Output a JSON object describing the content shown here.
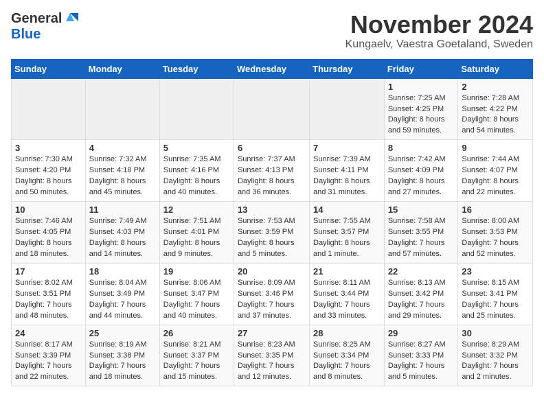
{
  "header": {
    "logo_general": "General",
    "logo_blue": "Blue",
    "month_title": "November 2024",
    "location": "Kungaelv, Vaestra Goetaland, Sweden"
  },
  "columns": [
    "Sunday",
    "Monday",
    "Tuesday",
    "Wednesday",
    "Thursday",
    "Friday",
    "Saturday"
  ],
  "weeks": [
    [
      {
        "day": "",
        "info": ""
      },
      {
        "day": "",
        "info": ""
      },
      {
        "day": "",
        "info": ""
      },
      {
        "day": "",
        "info": ""
      },
      {
        "day": "",
        "info": ""
      },
      {
        "day": "1",
        "info": "Sunrise: 7:25 AM\nSunset: 4:25 PM\nDaylight: 8 hours and 59 minutes."
      },
      {
        "day": "2",
        "info": "Sunrise: 7:28 AM\nSunset: 4:22 PM\nDaylight: 8 hours and 54 minutes."
      }
    ],
    [
      {
        "day": "3",
        "info": "Sunrise: 7:30 AM\nSunset: 4:20 PM\nDaylight: 8 hours and 50 minutes."
      },
      {
        "day": "4",
        "info": "Sunrise: 7:32 AM\nSunset: 4:18 PM\nDaylight: 8 hours and 45 minutes."
      },
      {
        "day": "5",
        "info": "Sunrise: 7:35 AM\nSunset: 4:16 PM\nDaylight: 8 hours and 40 minutes."
      },
      {
        "day": "6",
        "info": "Sunrise: 7:37 AM\nSunset: 4:13 PM\nDaylight: 8 hours and 36 minutes."
      },
      {
        "day": "7",
        "info": "Sunrise: 7:39 AM\nSunset: 4:11 PM\nDaylight: 8 hours and 31 minutes."
      },
      {
        "day": "8",
        "info": "Sunrise: 7:42 AM\nSunset: 4:09 PM\nDaylight: 8 hours and 27 minutes."
      },
      {
        "day": "9",
        "info": "Sunrise: 7:44 AM\nSunset: 4:07 PM\nDaylight: 8 hours and 22 minutes."
      }
    ],
    [
      {
        "day": "10",
        "info": "Sunrise: 7:46 AM\nSunset: 4:05 PM\nDaylight: 8 hours and 18 minutes."
      },
      {
        "day": "11",
        "info": "Sunrise: 7:49 AM\nSunset: 4:03 PM\nDaylight: 8 hours and 14 minutes."
      },
      {
        "day": "12",
        "info": "Sunrise: 7:51 AM\nSunset: 4:01 PM\nDaylight: 8 hours and 9 minutes."
      },
      {
        "day": "13",
        "info": "Sunrise: 7:53 AM\nSunset: 3:59 PM\nDaylight: 8 hours and 5 minutes."
      },
      {
        "day": "14",
        "info": "Sunrise: 7:55 AM\nSunset: 3:57 PM\nDaylight: 8 hours and 1 minute."
      },
      {
        "day": "15",
        "info": "Sunrise: 7:58 AM\nSunset: 3:55 PM\nDaylight: 7 hours and 57 minutes."
      },
      {
        "day": "16",
        "info": "Sunrise: 8:00 AM\nSunset: 3:53 PM\nDaylight: 7 hours and 52 minutes."
      }
    ],
    [
      {
        "day": "17",
        "info": "Sunrise: 8:02 AM\nSunset: 3:51 PM\nDaylight: 7 hours and 48 minutes."
      },
      {
        "day": "18",
        "info": "Sunrise: 8:04 AM\nSunset: 3:49 PM\nDaylight: 7 hours and 44 minutes."
      },
      {
        "day": "19",
        "info": "Sunrise: 8:06 AM\nSunset: 3:47 PM\nDaylight: 7 hours and 40 minutes."
      },
      {
        "day": "20",
        "info": "Sunrise: 8:09 AM\nSunset: 3:46 PM\nDaylight: 7 hours and 37 minutes."
      },
      {
        "day": "21",
        "info": "Sunrise: 8:11 AM\nSunset: 3:44 PM\nDaylight: 7 hours and 33 minutes."
      },
      {
        "day": "22",
        "info": "Sunrise: 8:13 AM\nSunset: 3:42 PM\nDaylight: 7 hours and 29 minutes."
      },
      {
        "day": "23",
        "info": "Sunrise: 8:15 AM\nSunset: 3:41 PM\nDaylight: 7 hours and 25 minutes."
      }
    ],
    [
      {
        "day": "24",
        "info": "Sunrise: 8:17 AM\nSunset: 3:39 PM\nDaylight: 7 hours and 22 minutes."
      },
      {
        "day": "25",
        "info": "Sunrise: 8:19 AM\nSunset: 3:38 PM\nDaylight: 7 hours and 18 minutes."
      },
      {
        "day": "26",
        "info": "Sunrise: 8:21 AM\nSunset: 3:37 PM\nDaylight: 7 hours and 15 minutes."
      },
      {
        "day": "27",
        "info": "Sunrise: 8:23 AM\nSunset: 3:35 PM\nDaylight: 7 hours and 12 minutes."
      },
      {
        "day": "28",
        "info": "Sunrise: 8:25 AM\nSunset: 3:34 PM\nDaylight: 7 hours and 8 minutes."
      },
      {
        "day": "29",
        "info": "Sunrise: 8:27 AM\nSunset: 3:33 PM\nDaylight: 7 hours and 5 minutes."
      },
      {
        "day": "30",
        "info": "Sunrise: 8:29 AM\nSunset: 3:32 PM\nDaylight: 7 hours and 2 minutes."
      }
    ]
  ]
}
